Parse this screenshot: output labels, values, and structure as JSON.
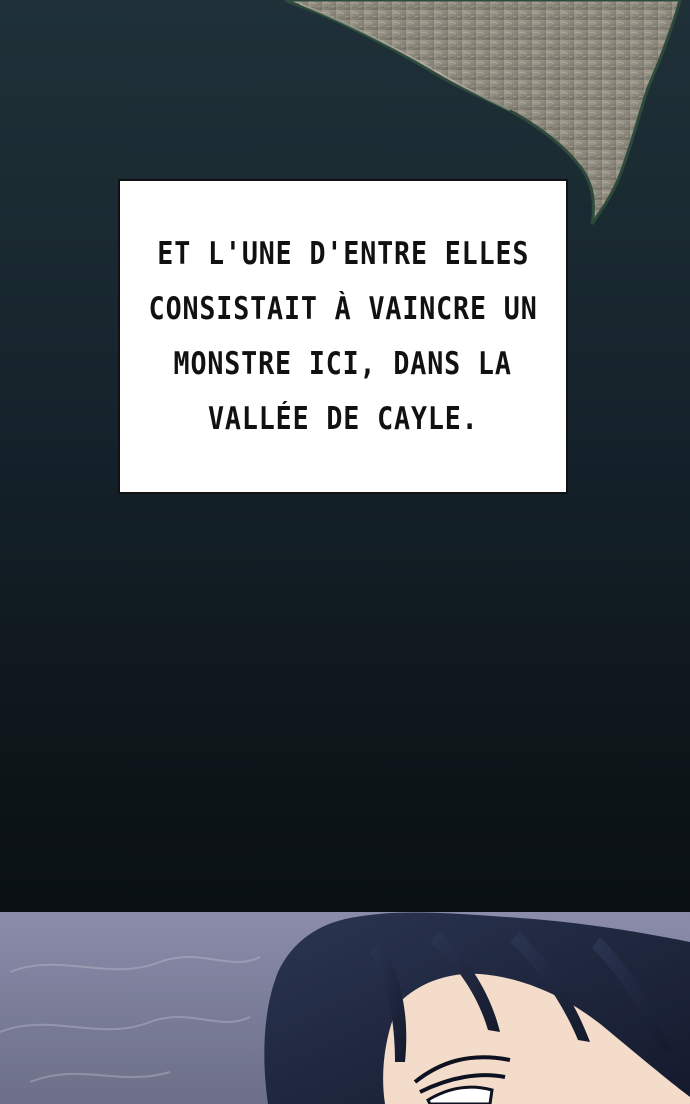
{
  "caption": {
    "lines": [
      "ET L'UNE D'ENTRE ELLES",
      "CONSISTAIT À VAINCRE UN",
      "MONSTRE ICI, DANS LA",
      "VALLÉE DE CAYLE."
    ]
  },
  "colors": {
    "background_top": "#1f3038",
    "background_bottom": "#0a1013",
    "caption_box": "#ffffff",
    "caption_text": "#111111",
    "rock": "#8f8a7e",
    "hair": "#1e2740",
    "skin": "#f4dccb",
    "sky": "#8688a6"
  },
  "icons": [
    "rock-illustration",
    "character-illustration"
  ]
}
